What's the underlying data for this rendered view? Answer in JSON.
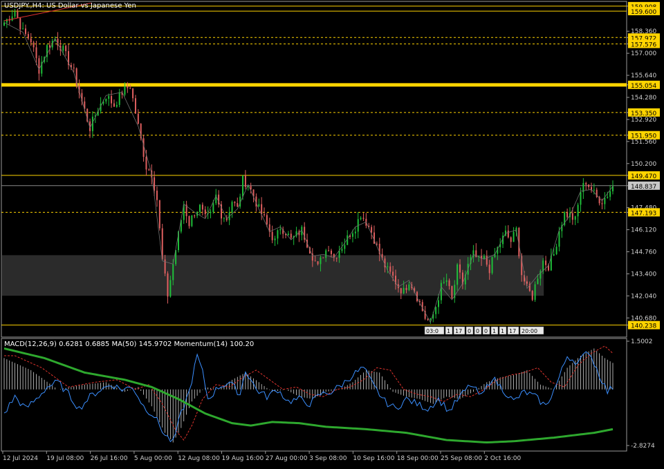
{
  "colors": {
    "background": "#000000",
    "frame": "#9a9a9a",
    "text": "#d0d0d0",
    "bull": "#1fbf3a",
    "bear": "#e06060",
    "level": "#ffd400",
    "zone": "#2b2b2b",
    "macd_hist": "#d8d8d8",
    "macd_signal": "#e0342d",
    "momentum": "#3b8fff",
    "ma": "#2ea82e",
    "trend": "#e03030"
  },
  "header": {
    "main_title": "USDJPY.,H4:  US Dollar vs Japanese Yen",
    "indicator_title": "MACD(12,26,9) 0.6281 0.6885 MA(50) 145.9702 Momentum(14) 100.20"
  },
  "mini_labels": [
    "03:0",
    "1",
    "17",
    "0",
    "0",
    "0",
    "1",
    "1",
    "17",
    "20:00"
  ],
  "chart_data": [
    {
      "type": "candlestick",
      "title": "USDJPY.,H4:  US Dollar vs Japanese Yen",
      "ylim": [
        139.5,
        160.2
      ],
      "y_ticks": [
        "159.908",
        "158.360",
        "157.972",
        "157.576",
        "157.000",
        "155.640",
        "155.054",
        "154.280",
        "153.350",
        "152.920",
        "151.950",
        "151.560",
        "150.200",
        "149.470",
        "148.837",
        "147.480",
        "147.193",
        "146.120",
        "144.760",
        "143.400",
        "142.040",
        "140.680",
        "140.238"
      ],
      "x_labels": [
        "12 Jul 2024",
        "19 Jul 08:00",
        "26 Jul 16:00",
        "5 Aug 00:00",
        "12 Aug 08:00",
        "19 Aug 16:00",
        "27 Aug 00:00",
        "3 Sep 08:00",
        "10 Sep 16:00",
        "18 Sep 00:00",
        "25 Sep 08:00",
        "2 Oct 16:00"
      ],
      "close_path": [
        [
          0,
          158.9
        ],
        [
          4,
          159.6
        ],
        [
          7,
          158.3
        ],
        [
          10,
          157.8
        ],
        [
          13,
          156.0
        ],
        [
          16,
          157.4
        ],
        [
          19,
          157.9
        ],
        [
          22,
          157.2
        ],
        [
          26,
          155.8
        ],
        [
          29,
          154.0
        ],
        [
          32,
          152.4
        ],
        [
          35,
          153.6
        ],
        [
          38,
          154.4
        ],
        [
          41,
          153.8
        ],
        [
          44,
          154.6
        ],
        [
          47,
          155.0
        ],
        [
          50,
          152.5
        ],
        [
          53,
          150.0
        ],
        [
          55,
          149.6
        ],
        [
          57,
          148.0
        ],
        [
          59,
          144.2
        ],
        [
          61,
          142.1
        ],
        [
          63,
          144.0
        ],
        [
          65,
          145.8
        ],
        [
          67,
          147.7
        ],
        [
          69,
          146.5
        ],
        [
          71,
          147.2
        ],
        [
          73,
          147.5
        ],
        [
          75,
          146.8
        ],
        [
          77,
          147.0
        ],
        [
          79,
          148.2
        ],
        [
          81,
          147.1
        ],
        [
          83,
          146.8
        ],
        [
          85,
          147.9
        ],
        [
          87,
          147.4
        ],
        [
          89,
          149.2
        ],
        [
          91,
          148.9
        ],
        [
          93,
          148.2
        ],
        [
          95,
          147.4
        ],
        [
          97,
          146.8
        ],
        [
          99,
          146.0
        ],
        [
          101,
          145.4
        ],
        [
          103,
          146.3
        ],
        [
          105,
          146.0
        ],
        [
          107,
          145.5
        ],
        [
          109,
          145.8
        ],
        [
          111,
          146.1
        ],
        [
          113,
          145.3
        ],
        [
          115,
          144.5
        ],
        [
          117,
          143.8
        ],
        [
          119,
          144.6
        ],
        [
          121,
          145.1
        ],
        [
          123,
          144.4
        ],
        [
          125,
          144.9
        ],
        [
          127,
          145.3
        ],
        [
          129,
          145.9
        ],
        [
          131,
          146.3
        ],
        [
          133,
          147.1
        ],
        [
          135,
          146.6
        ],
        [
          137,
          146.0
        ],
        [
          139,
          145.1
        ],
        [
          141,
          144.2
        ],
        [
          143,
          143.6
        ],
        [
          145,
          143.2
        ],
        [
          147,
          142.6
        ],
        [
          149,
          142.3
        ],
        [
          151,
          143.0
        ],
        [
          153,
          142.4
        ],
        [
          155,
          141.6
        ],
        [
          157,
          140.7
        ],
        [
          159,
          140.4
        ],
        [
          161,
          141.4
        ],
        [
          163,
          142.6
        ],
        [
          165,
          143.0
        ],
        [
          167,
          141.8
        ],
        [
          169,
          143.7
        ],
        [
          171,
          142.8
        ],
        [
          173,
          143.9
        ],
        [
          175,
          144.6
        ],
        [
          177,
          144.2
        ],
        [
          179,
          144.3
        ],
        [
          181,
          143.7
        ],
        [
          183,
          144.6
        ],
        [
          185,
          145.3
        ],
        [
          187,
          145.9
        ],
        [
          189,
          145.4
        ],
        [
          191,
          146.1
        ],
        [
          193,
          143.4
        ],
        [
          195,
          142.5
        ],
        [
          197,
          142.0
        ],
        [
          199,
          143.3
        ],
        [
          201,
          144.2
        ],
        [
          203,
          143.9
        ],
        [
          205,
          144.6
        ],
        [
          207,
          146.1
        ],
        [
          209,
          147.1
        ],
        [
          211,
          147.0
        ],
        [
          213,
          146.7
        ],
        [
          215,
          148.5
        ],
        [
          217,
          149.1
        ],
        [
          219,
          148.6
        ],
        [
          221,
          148.1
        ],
        [
          223,
          147.9
        ],
        [
          225,
          148.3
        ],
        [
          227,
          148.8
        ]
      ],
      "levels": [
        {
          "value": 159.908,
          "label": "159.908",
          "style": "solid"
        },
        {
          "value": 159.6,
          "label": "159.600",
          "style": "solid"
        },
        {
          "value": 157.972,
          "label": "157.972",
          "style": "dashed"
        },
        {
          "value": 157.576,
          "label": "157.576",
          "style": "dashed"
        },
        {
          "value": 155.054,
          "label": "155.054",
          "style": "thick"
        },
        {
          "value": 153.35,
          "label": "153.350",
          "style": "dashed"
        },
        {
          "value": 151.95,
          "label": "151.950",
          "style": "dashed"
        },
        {
          "value": 149.47,
          "label": "149.470",
          "style": "solid"
        },
        {
          "value": 147.193,
          "label": "147.193",
          "style": "dashed"
        },
        {
          "value": 140.238,
          "label": "140.238",
          "style": "solid"
        }
      ],
      "current_price": {
        "value": 148.837,
        "label": "148.837"
      },
      "zone": {
        "from_index": 0,
        "to_index": 201,
        "low": 142.05,
        "high": 144.55
      },
      "trendline": {
        "from": [
          0,
          159.0
        ],
        "to": [
          17,
          160.1
        ]
      }
    },
    {
      "type": "line",
      "title": "MACD(12,26,9) 0.6281 0.6885 MA(50) 145.9702 Momentum(14) 100.20",
      "ylim": [
        -2.8274,
        1.5002
      ],
      "y_ticks": [
        "1.5002",
        "-2.8274"
      ],
      "zero_value": -0.5,
      "macd_anchors": [
        [
          0,
          0.8
        ],
        [
          10,
          0.3
        ],
        [
          20,
          -0.5
        ],
        [
          30,
          -0.3
        ],
        [
          38,
          -0.2
        ],
        [
          45,
          -0.6
        ],
        [
          50,
          -0.4
        ],
        [
          55,
          -1.2
        ],
        [
          60,
          -2.3
        ],
        [
          63,
          -2.7
        ],
        [
          66,
          -2.1
        ],
        [
          70,
          -1.0
        ],
        [
          75,
          -0.4
        ],
        [
          80,
          -0.5
        ],
        [
          85,
          -0.1
        ],
        [
          90,
          0.2
        ],
        [
          95,
          -0.2
        ],
        [
          100,
          -0.6
        ],
        [
          105,
          -0.5
        ],
        [
          110,
          -0.8
        ],
        [
          115,
          -0.9
        ],
        [
          120,
          -0.6
        ],
        [
          125,
          -0.5
        ],
        [
          130,
          -0.2
        ],
        [
          135,
          0.3
        ],
        [
          140,
          0.2
        ],
        [
          145,
          -0.6
        ],
        [
          150,
          -0.8
        ],
        [
          155,
          -0.9
        ],
        [
          160,
          -1.1
        ],
        [
          165,
          -0.8
        ],
        [
          170,
          -0.9
        ],
        [
          175,
          -0.6
        ],
        [
          180,
          -0.2
        ],
        [
          185,
          0.0
        ],
        [
          190,
          0.1
        ],
        [
          195,
          0.3
        ],
        [
          200,
          -0.3
        ],
        [
          205,
          -0.5
        ],
        [
          210,
          0.4
        ],
        [
          215,
          0.9
        ],
        [
          220,
          1.2
        ],
        [
          224,
          0.8
        ],
        [
          227,
          0.6
        ]
      ],
      "momentum_anchors": [
        [
          0,
          -1.5
        ],
        [
          4,
          -0.8
        ],
        [
          8,
          -1.3
        ],
        [
          12,
          -0.9
        ],
        [
          16,
          -0.4
        ],
        [
          20,
          -0.2
        ],
        [
          24,
          -0.7
        ],
        [
          28,
          -1.3
        ],
        [
          32,
          -0.8
        ],
        [
          36,
          -0.5
        ],
        [
          40,
          -0.3
        ],
        [
          44,
          -0.5
        ],
        [
          48,
          -0.4
        ],
        [
          52,
          -1.2
        ],
        [
          56,
          -1.6
        ],
        [
          60,
          -2.4
        ],
        [
          63,
          -2.7
        ],
        [
          66,
          -1.5
        ],
        [
          69,
          -0.6
        ],
        [
          72,
          0.9
        ],
        [
          74,
          0.2
        ],
        [
          76,
          -0.9
        ],
        [
          80,
          -0.4
        ],
        [
          84,
          -0.2
        ],
        [
          88,
          -0.7
        ],
        [
          90,
          0.3
        ],
        [
          94,
          -0.5
        ],
        [
          98,
          -0.8
        ],
        [
          102,
          -0.5
        ],
        [
          106,
          -1.0
        ],
        [
          110,
          -0.9
        ],
        [
          114,
          -1.1
        ],
        [
          118,
          -0.7
        ],
        [
          122,
          -0.6
        ],
        [
          126,
          -0.3
        ],
        [
          130,
          0.1
        ],
        [
          134,
          0.4
        ],
        [
          138,
          -0.4
        ],
        [
          142,
          -1.0
        ],
        [
          146,
          -1.3
        ],
        [
          150,
          -0.9
        ],
        [
          154,
          -1.1
        ],
        [
          158,
          -1.3
        ],
        [
          162,
          -0.9
        ],
        [
          166,
          -1.4
        ],
        [
          170,
          -0.8
        ],
        [
          174,
          -0.3
        ],
        [
          178,
          -0.8
        ],
        [
          182,
          0.0
        ],
        [
          186,
          -0.5
        ],
        [
          190,
          -1.0
        ],
        [
          194,
          -0.6
        ],
        [
          198,
          -0.8
        ],
        [
          202,
          -1.2
        ],
        [
          206,
          -0.3
        ],
        [
          210,
          0.9
        ],
        [
          214,
          0.6
        ],
        [
          218,
          1.1
        ],
        [
          222,
          0.1
        ],
        [
          225,
          -0.6
        ],
        [
          227,
          -0.4
        ]
      ],
      "ma_anchors": [
        [
          0,
          1.2
        ],
        [
          15,
          0.8
        ],
        [
          30,
          0.2
        ],
        [
          45,
          -0.1
        ],
        [
          55,
          -0.4
        ],
        [
          65,
          -0.9
        ],
        [
          75,
          -1.5
        ],
        [
          85,
          -1.9
        ],
        [
          92,
          -2.0
        ],
        [
          100,
          -1.85
        ],
        [
          110,
          -1.9
        ],
        [
          120,
          -2.05
        ],
        [
          135,
          -2.15
        ],
        [
          150,
          -2.3
        ],
        [
          165,
          -2.6
        ],
        [
          180,
          -2.7
        ],
        [
          190,
          -2.65
        ],
        [
          205,
          -2.5
        ],
        [
          220,
          -2.3
        ],
        [
          227,
          -2.15
        ]
      ]
    }
  ]
}
